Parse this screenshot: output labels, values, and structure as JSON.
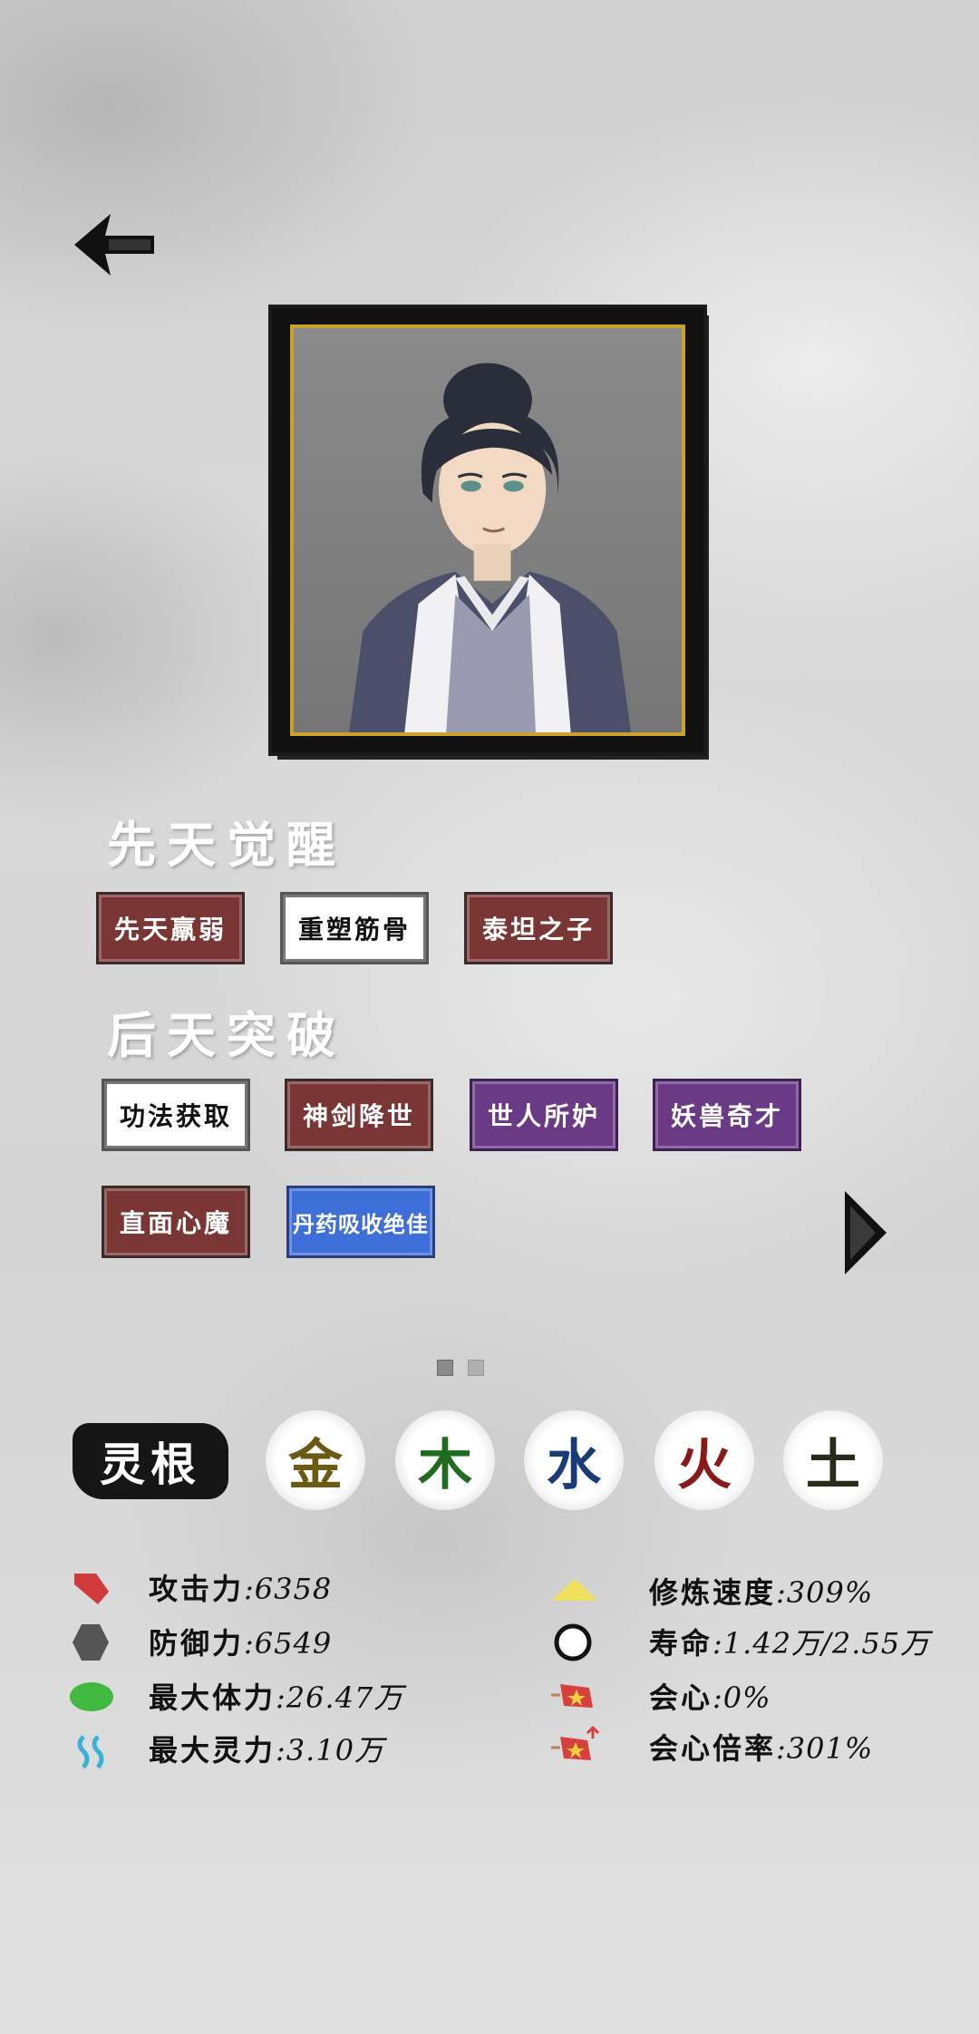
{
  "sections": {
    "innate_title": "先天觉醒",
    "acquired_title": "后天突破"
  },
  "innate_tags": [
    "先天羸弱",
    "重塑筋骨",
    "泰坦之子"
  ],
  "acquired_tags": [
    "功法获取",
    "神剑降世",
    "世人所妒",
    "妖兽奇才",
    "直面心魔",
    "丹药吸收绝佳"
  ],
  "spirit_root": {
    "label": "灵根",
    "elements": [
      "金",
      "木",
      "水",
      "火",
      "土"
    ]
  },
  "stats": {
    "attack": {
      "label": "攻击力",
      "value": ":6358"
    },
    "defense": {
      "label": "防御力",
      "value": ":6549"
    },
    "max_hp": {
      "label": "最大体力",
      "value": ":26.47万"
    },
    "max_spirit": {
      "label": "最大灵力",
      "value": ":3.10万"
    },
    "cultivation_speed": {
      "label": "修炼速度",
      "value": ":309%"
    },
    "lifespan": {
      "label": "寿命",
      "value": ":1.42万/2.55万"
    },
    "crit": {
      "label": "会心",
      "value": ":0%"
    },
    "crit_multiplier": {
      "label": "会心倍率",
      "value": ":301%"
    }
  },
  "pagination": {
    "current": 1,
    "total": 2
  },
  "icons": {
    "back": "back-arrow-icon",
    "next": "next-page-icon"
  },
  "colors": {
    "tag_red": "#7a3535",
    "tag_purple": "#6b3a86",
    "tag_blue": "#3e6fd9",
    "metal": "#6b5a12",
    "wood": "#1f6b1f",
    "water": "#1b3a78",
    "fire": "#8a1a1a",
    "earth": "#2a2a1a",
    "frame_gold": "#c9a227"
  }
}
